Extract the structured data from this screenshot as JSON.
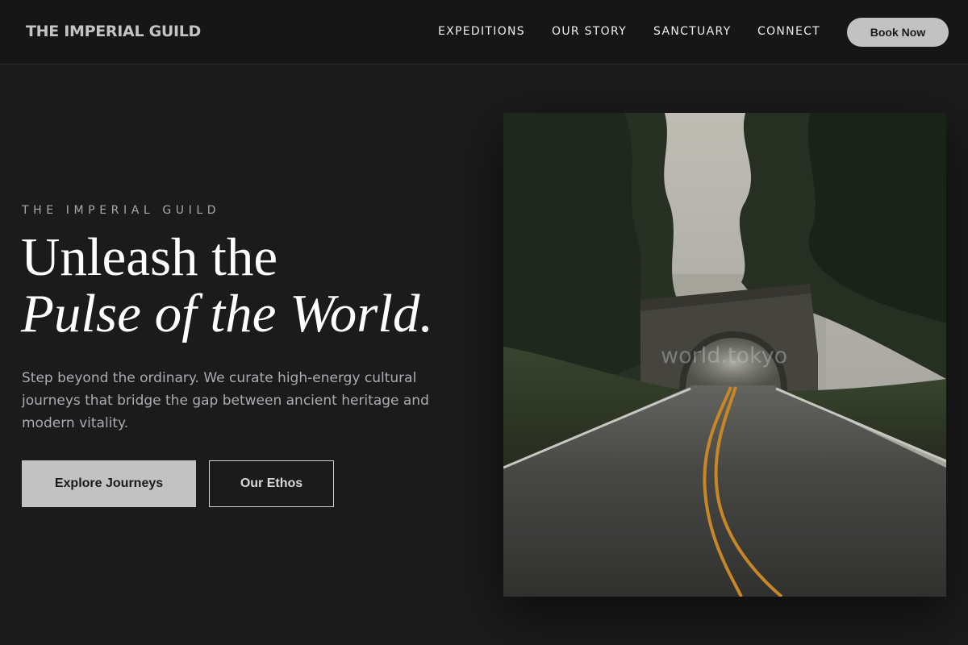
{
  "nav": {
    "logo": "THE IMPERIAL GUILD",
    "links": [
      "EXPEDITIONS",
      "OUR STORY",
      "SANCTUARY",
      "CONNECT"
    ],
    "cta": "Book Now"
  },
  "hero": {
    "eyebrow": "THE IMPERIAL GUILD",
    "headline_line1": "Unleash the",
    "headline_line2": "Pulse of the World.",
    "description": "Step beyond the ordinary. We curate high-energy cultural journeys that bridge the gap between ancient heritage and modern vitality.",
    "primary_button": "Explore Journeys",
    "secondary_button": "Our Ethos",
    "image_watermark": "world.tokyo",
    "image_subject": "road-through-stone-bridge-tunnel-photo"
  },
  "colors": {
    "background": "#1b1b1b",
    "nav_background": "#161616",
    "button_light": "#c2c2c2",
    "text_muted": "#a9acb2",
    "road_line": "#d9932a"
  }
}
